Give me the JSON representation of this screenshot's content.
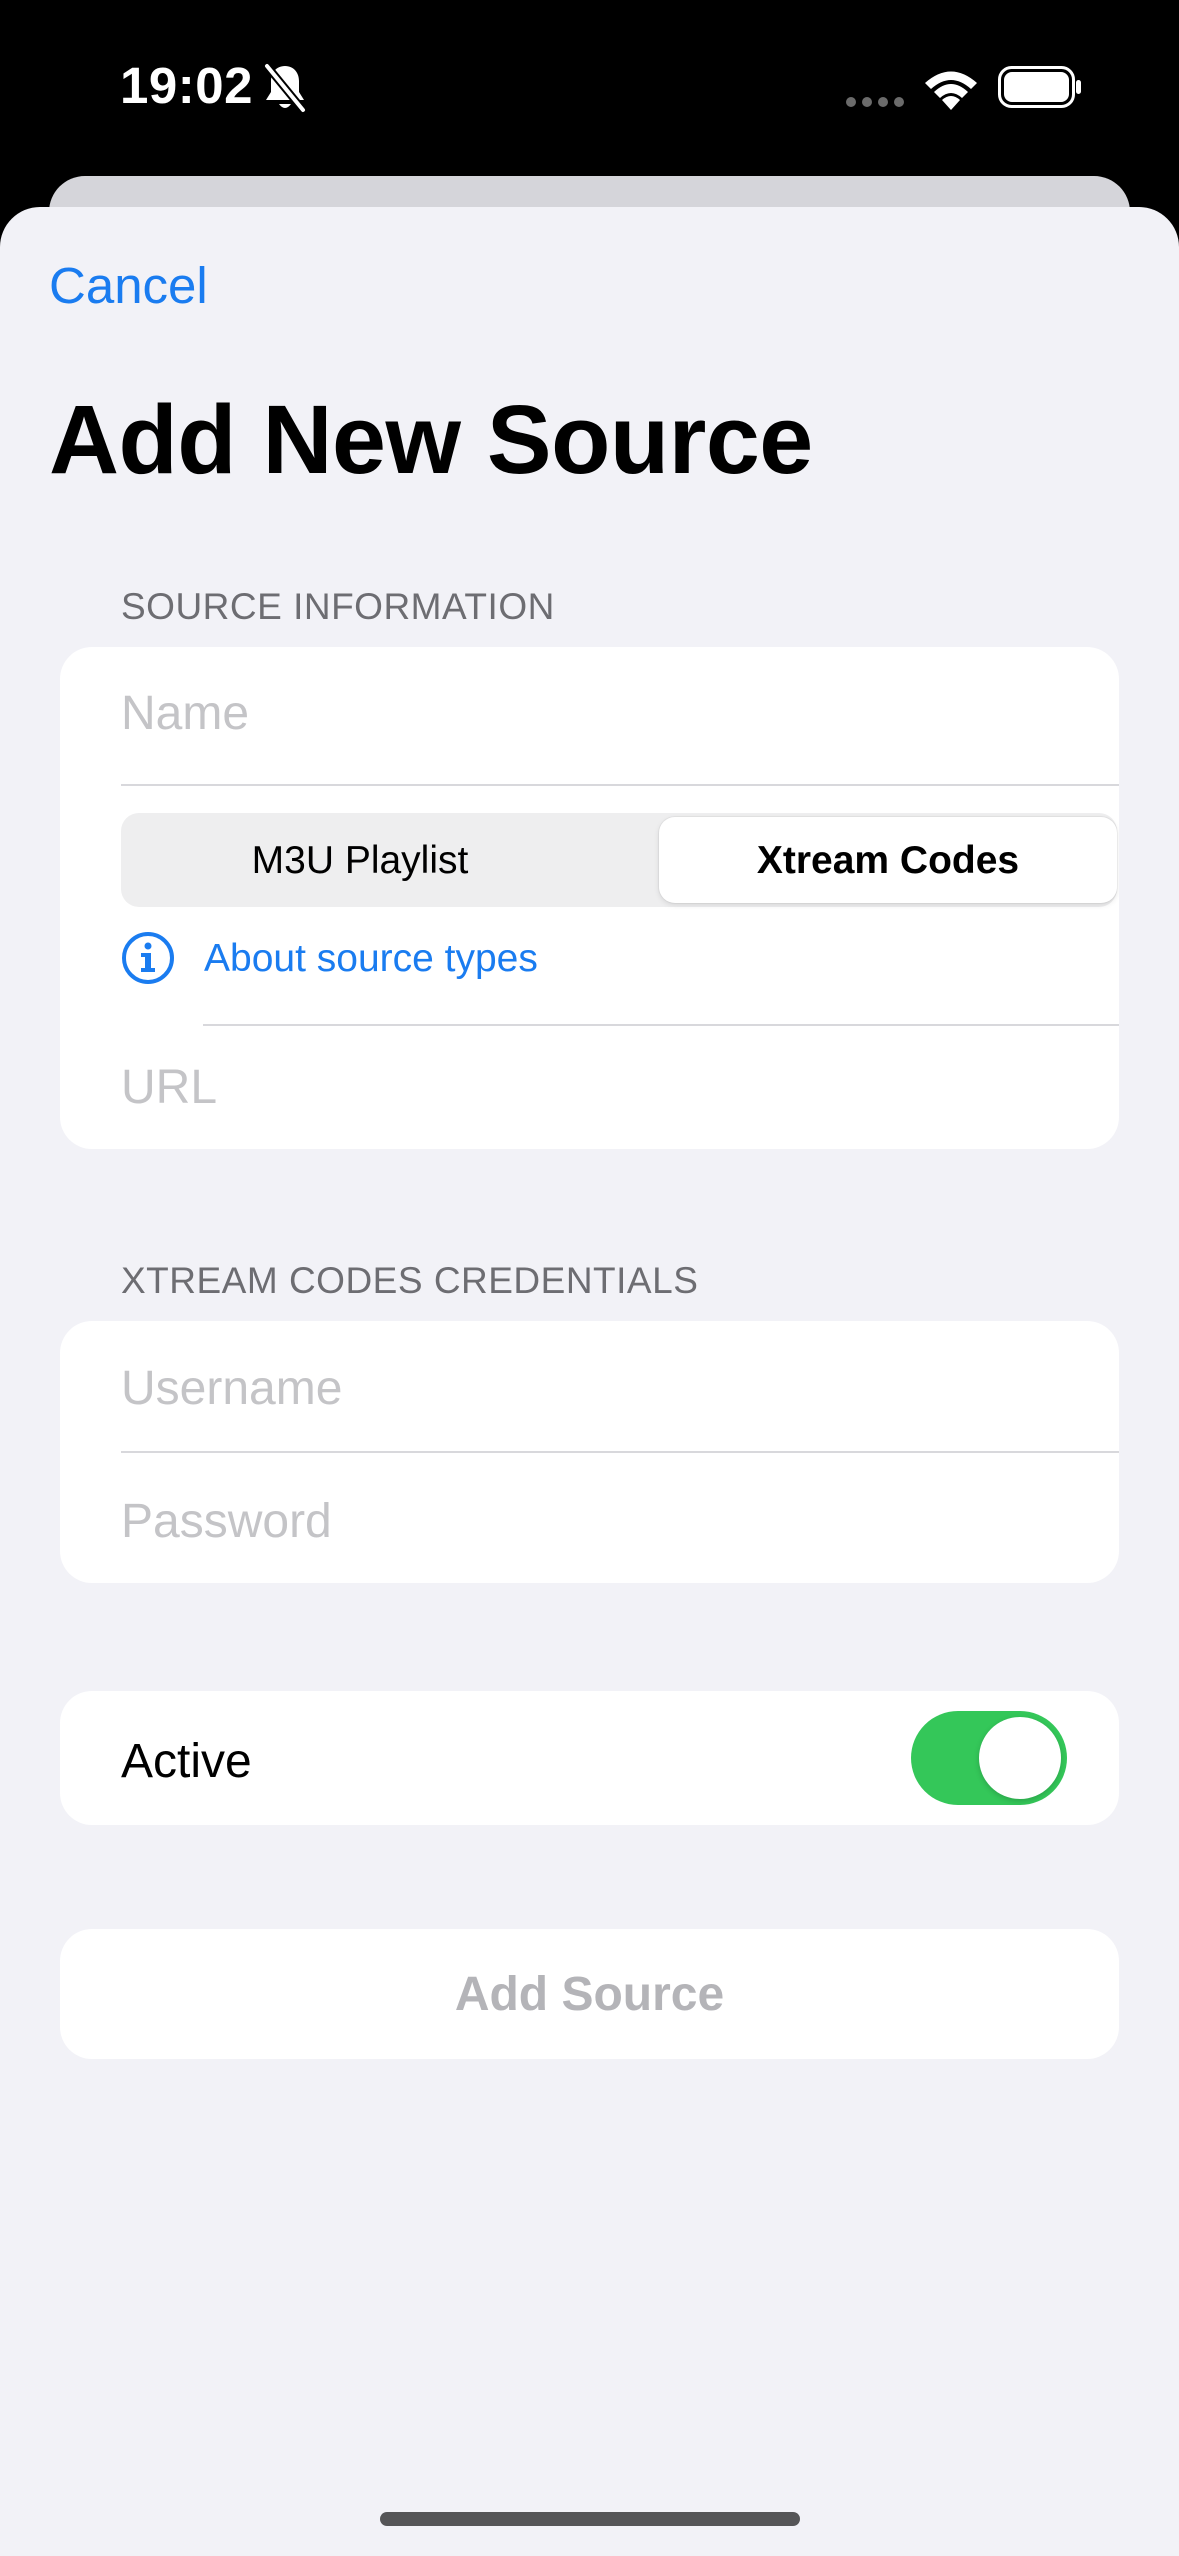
{
  "status_bar": {
    "time": "19:02",
    "icons": [
      "bell-slash-icon",
      "signal-dots-icon",
      "wifi-icon",
      "battery-icon"
    ]
  },
  "nav": {
    "cancel_label": "Cancel",
    "title": "Add New Source"
  },
  "source_information": {
    "header": "SOURCE INFORMATION",
    "name_placeholder": "Name",
    "source_types": [
      {
        "label": "M3U Playlist",
        "selected": false
      },
      {
        "label": "Xtream Codes",
        "selected": true
      }
    ],
    "about_link": "About source types",
    "about_icon": "info-circle-icon",
    "url_placeholder": "URL"
  },
  "credentials": {
    "header": "XTREAM CODES CREDENTIALS",
    "username_placeholder": "Username",
    "password_placeholder": "Password"
  },
  "active": {
    "label": "Active",
    "on": true
  },
  "add_button_label": "Add Source",
  "colors": {
    "accent": "#1a7cf0",
    "toggle_on": "#34c759",
    "background": "#f2f2f7",
    "disabled_text": "#b4b4b8"
  }
}
